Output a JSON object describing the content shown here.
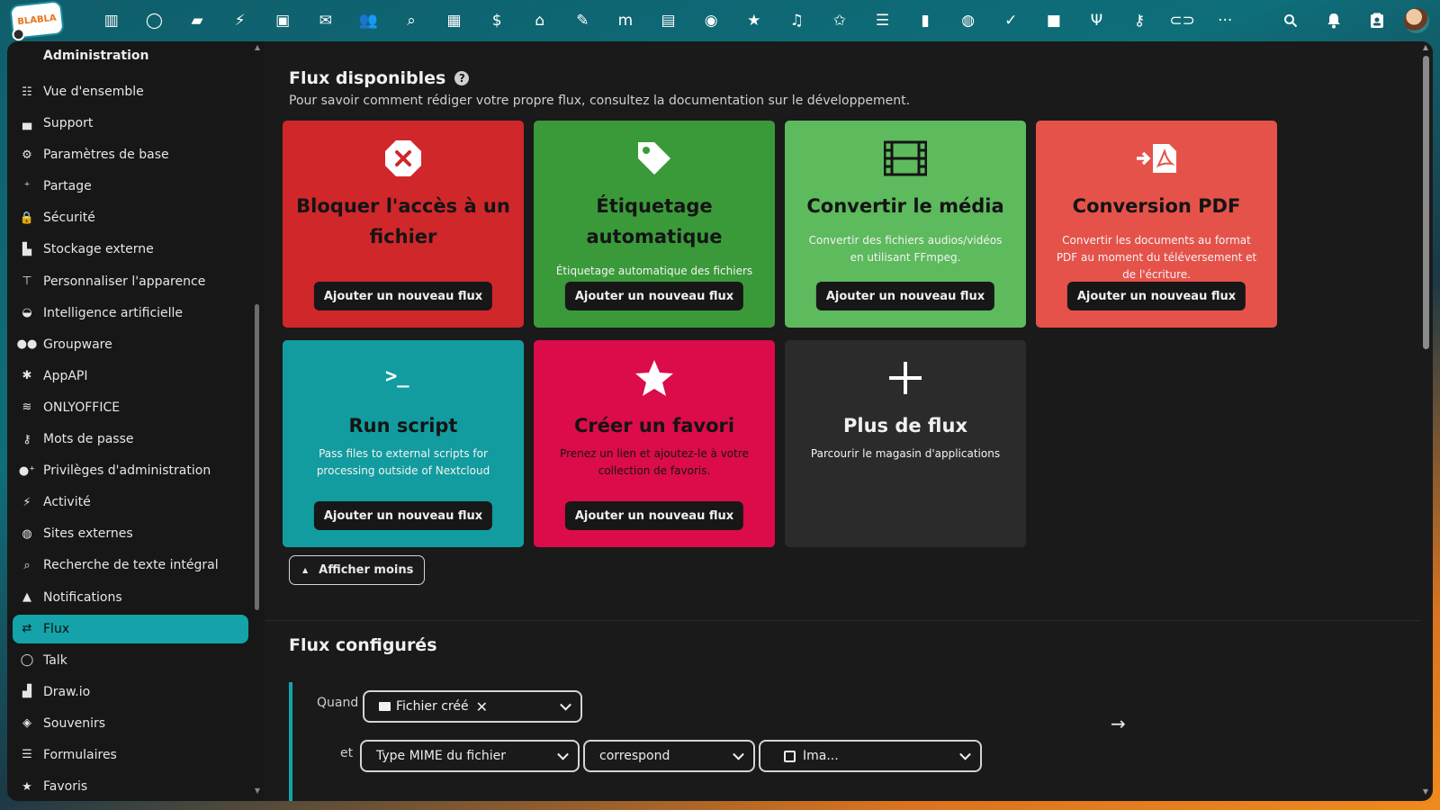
{
  "topbar": {
    "logo_text": "BLABLA",
    "apps": [
      {
        "name": "dashboard-icon",
        "glyph": "▥"
      },
      {
        "name": "talk-icon",
        "glyph": "◯"
      },
      {
        "name": "files-icon",
        "glyph": "▰"
      },
      {
        "name": "activity-icon",
        "glyph": "⚡"
      },
      {
        "name": "photos-icon",
        "glyph": "▣"
      },
      {
        "name": "mail-icon",
        "glyph": "✉"
      },
      {
        "name": "contacts-icon",
        "glyph": "👥"
      },
      {
        "name": "search-icon",
        "glyph": "⌕"
      },
      {
        "name": "calendar-icon",
        "glyph": "▦"
      },
      {
        "name": "money-bag-icon",
        "glyph": "$"
      },
      {
        "name": "cleaning-icon",
        "glyph": "⌂"
      },
      {
        "name": "pencil-icon",
        "glyph": "✎"
      },
      {
        "name": "mastodon-icon",
        "glyph": "m"
      },
      {
        "name": "drive-icon",
        "glyph": "▤"
      },
      {
        "name": "github-icon",
        "glyph": "◉"
      },
      {
        "name": "star-icon",
        "glyph": "★"
      },
      {
        "name": "music-icon",
        "glyph": "♫"
      },
      {
        "name": "star-person-icon",
        "glyph": "✩"
      },
      {
        "name": "list-icon",
        "glyph": "☰"
      },
      {
        "name": "chart-icon",
        "glyph": "▮"
      },
      {
        "name": "globe-icon",
        "glyph": "◍"
      },
      {
        "name": "check-icon",
        "glyph": "✓"
      },
      {
        "name": "video-icon",
        "glyph": "■"
      },
      {
        "name": "cookbook-icon",
        "glyph": "Ψ"
      },
      {
        "name": "key-icon",
        "glyph": "⚷"
      },
      {
        "name": "ocs-icon",
        "glyph": "⊂⊃"
      },
      {
        "name": "more-apps-icon",
        "glyph": "···"
      }
    ],
    "right": [
      {
        "name": "unified-search-icon",
        "glyph": "⌕"
      },
      {
        "name": "notifications-icon",
        "glyph": "🔔"
      },
      {
        "name": "contacts-menu-icon",
        "glyph": "▣"
      }
    ]
  },
  "sidebar": {
    "title": "Administration",
    "items": [
      {
        "label": "Vue d'ensemble",
        "icon": "overview-icon",
        "glyph": "☷",
        "active": false
      },
      {
        "label": "Support",
        "icon": "support-icon",
        "glyph": "▄",
        "active": false
      },
      {
        "label": "Paramètres de base",
        "icon": "settings-icon",
        "glyph": "⚙",
        "active": false
      },
      {
        "label": "Partage",
        "icon": "share-icon",
        "glyph": "⁺",
        "active": false
      },
      {
        "label": "Sécurité",
        "icon": "lock-icon",
        "glyph": "🔒",
        "active": false
      },
      {
        "label": "Stockage externe",
        "icon": "external-storage-icon",
        "glyph": "▙",
        "active": false
      },
      {
        "label": "Personnaliser l'apparence",
        "icon": "paint-roller-icon",
        "glyph": "⊤",
        "active": false
      },
      {
        "label": "Intelligence artificielle",
        "icon": "robot-icon",
        "glyph": "◒",
        "active": false
      },
      {
        "label": "Groupware",
        "icon": "groupware-icon",
        "glyph": "●●",
        "active": false
      },
      {
        "label": "AppAPI",
        "icon": "appapi-icon",
        "glyph": "✱",
        "active": false
      },
      {
        "label": "ONLYOFFICE",
        "icon": "onlyoffice-icon",
        "glyph": "≋",
        "active": false
      },
      {
        "label": "Mots de passe",
        "icon": "key-icon",
        "glyph": "⚷",
        "active": false
      },
      {
        "label": "Privilèges d'administration",
        "icon": "admin-privileges-icon",
        "glyph": "●⁺",
        "active": false
      },
      {
        "label": "Activité",
        "icon": "activity-icon",
        "glyph": "⚡",
        "active": false
      },
      {
        "label": "Sites externes",
        "icon": "globe-icon",
        "glyph": "◍",
        "active": false
      },
      {
        "label": "Recherche de texte intégral",
        "icon": "search-icon",
        "glyph": "⌕",
        "active": false
      },
      {
        "label": "Notifications",
        "icon": "bell-icon",
        "glyph": "▲",
        "active": false
      },
      {
        "label": "Flux",
        "icon": "flow-icon",
        "glyph": "⇄",
        "active": true
      },
      {
        "label": "Talk",
        "icon": "talk-icon",
        "glyph": "◯",
        "active": false
      },
      {
        "label": "Draw.io",
        "icon": "drawio-icon",
        "glyph": "▟",
        "active": false
      },
      {
        "label": "Souvenirs",
        "icon": "memories-icon",
        "glyph": "◈",
        "active": false
      },
      {
        "label": "Formulaires",
        "icon": "forms-icon",
        "glyph": "☰",
        "active": false
      },
      {
        "label": "Favoris",
        "icon": "star-icon",
        "glyph": "★",
        "active": false
      }
    ]
  },
  "main": {
    "available": {
      "title": "Flux disponibles",
      "description": "Pour savoir comment rédiger votre propre flux, consultez la documentation sur le développement.",
      "cards": [
        {
          "key": "block",
          "title": "Bloquer l'accès à un fichier",
          "desc": "",
          "button": "Ajouter un nouveau flux",
          "color": "#d0272b",
          "icon": "block-access-icon"
        },
        {
          "key": "tag",
          "title": "Étiquetage automatique",
          "desc": "Étiquetage automatique des fichiers",
          "button": "Ajouter un nouveau flux",
          "color": "#3a9a3a",
          "icon": "tag-icon"
        },
        {
          "key": "media",
          "title": "Convertir le média",
          "desc": "Convertir des fichiers audios/vidéos en utilisant FFmpeg.",
          "button": "Ajouter un nouveau flux",
          "color": "#5dba5d",
          "icon": "film-icon"
        },
        {
          "key": "pdf",
          "title": "Conversion PDF",
          "desc": "Convertir les documents au format PDF au moment du téléversement et de l'écriture.",
          "button": "Ajouter un nouveau flux",
          "color": "#e5524a",
          "icon": "pdf-convert-icon"
        },
        {
          "key": "script",
          "title": "Run script",
          "desc": "Pass files to external scripts for processing outside of Nextcloud",
          "button": "Ajouter un nouveau flux",
          "color": "#129c9f",
          "icon": "terminal-icon"
        },
        {
          "key": "fav",
          "title": "Créer un favori",
          "desc": "Prenez un lien et ajoutez-le à votre collection de favoris.",
          "button": "Ajouter un nouveau flux",
          "color": "#dc0b49",
          "icon": "star-icon"
        },
        {
          "key": "more",
          "title": "Plus de flux",
          "desc": "Parcourir le magasin d'applications",
          "button": "",
          "color": "#2b2b2b",
          "icon": "plus-icon"
        }
      ],
      "show_less": "Afficher moins"
    },
    "configured": {
      "title": "Flux configurés",
      "when_label": "Quand",
      "and_label": "et",
      "event_chip": "Fichier créé",
      "check_select": "Type MIME du fichier",
      "operator_select": "correspond",
      "value_select": "Ima..."
    }
  },
  "colors": {
    "accent": "#13a3a9",
    "sidebar_bg": "#171717",
    "main_bg": "#1a1a1a"
  }
}
